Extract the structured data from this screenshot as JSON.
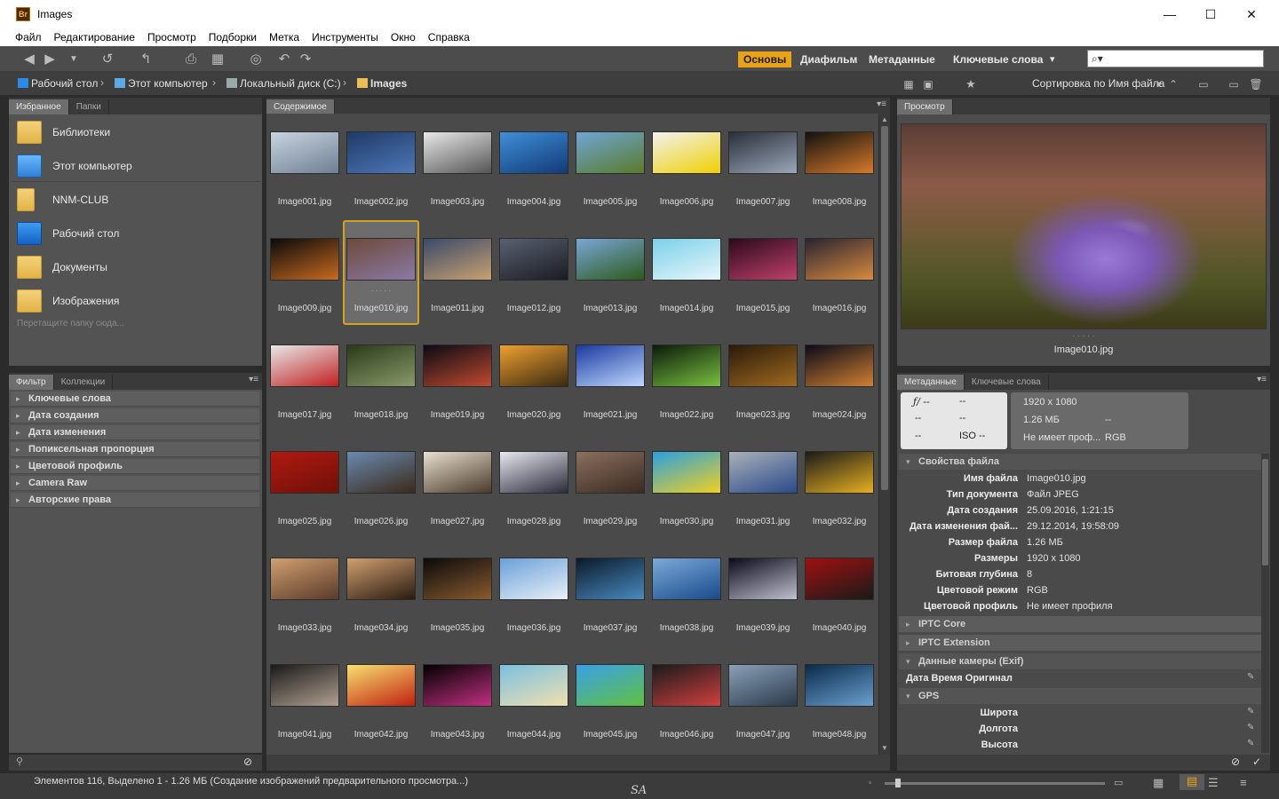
{
  "window": {
    "title": "Images",
    "icon_text": "Br",
    "min": "—",
    "max": "☐",
    "close": "✕"
  },
  "menu": [
    "Файл",
    "Редактирование",
    "Просмотр",
    "Подборки",
    "Метка",
    "Инструменты",
    "Окно",
    "Справка"
  ],
  "workspaces": {
    "essentials": "Основы",
    "filmstrip": "Диафильм",
    "metadata": "Метаданные",
    "keywords": "Ключевые слова",
    "more": "▾"
  },
  "search": {
    "placeholder": "⌕▾"
  },
  "path": {
    "desktop": "Рабочий стол",
    "computer": "Этот компьютер",
    "disk": "Локальный диск (C:)",
    "folder": "Images"
  },
  "sort": {
    "label": "Сортировка по Имя файла"
  },
  "favorites": {
    "tabs": [
      "Избранное",
      "Папки"
    ],
    "items": [
      "Библиотеки",
      "Этот компьютер",
      "NNM-CLUB",
      "Рабочий стол",
      "Документы",
      "Изображения"
    ],
    "drop_hint": "Перетащите папку сюда..."
  },
  "filter": {
    "tabs": [
      "Фильтр",
      "Коллекции"
    ],
    "rows": [
      "Ключевые слова",
      "Дата создания",
      "Дата изменения",
      "Попиксельная пропорция",
      "Цветовой профиль",
      "Camera Raw",
      "Авторские права"
    ]
  },
  "content": {
    "tab": "Содержимое",
    "selected_index": 9,
    "images": [
      {
        "name": "Image001.jpg",
        "c1": "#c8d4e0",
        "c2": "#6f7f92"
      },
      {
        "name": "Image002.jpg",
        "c1": "#1f3a66",
        "c2": "#4e78b8"
      },
      {
        "name": "Image003.jpg",
        "c1": "#e8e8e8",
        "c2": "#555"
      },
      {
        "name": "Image004.jpg",
        "c1": "#3f8fd8",
        "c2": "#123a78"
      },
      {
        "name": "Image005.jpg",
        "c1": "#6ea6d6",
        "c2": "#5a7a2a"
      },
      {
        "name": "Image006.jpg",
        "c1": "#f2f2f2",
        "c2": "#f0d000"
      },
      {
        "name": "Image007.jpg",
        "c1": "#2a2f3a",
        "c2": "#9aa6b8"
      },
      {
        "name": "Image008.jpg",
        "c1": "#111",
        "c2": "#d87a2a"
      },
      {
        "name": "Image009.jpg",
        "c1": "#0a0a0a",
        "c2": "#c86a20"
      },
      {
        "name": "Image010.jpg",
        "c1": "#6e4a3a",
        "c2": "#8a7aa6"
      },
      {
        "name": "Image011.jpg",
        "c1": "#3a4a6a",
        "c2": "#c8a070"
      },
      {
        "name": "Image012.jpg",
        "c1": "#5a6070",
        "c2": "#1a1c22"
      },
      {
        "name": "Image013.jpg",
        "c1": "#7aa6d6",
        "c2": "#2c5a1c"
      },
      {
        "name": "Image014.jpg",
        "c1": "#7ad0ea",
        "c2": "#e8f6fa"
      },
      {
        "name": "Image015.jpg",
        "c1": "#2a0a1a",
        "c2": "#c0406a"
      },
      {
        "name": "Image016.jpg",
        "c1": "#2a2430",
        "c2": "#d88a40"
      },
      {
        "name": "Image017.jpg",
        "c1": "#e8e8e8",
        "c2": "#c02020"
      },
      {
        "name": "Image018.jpg",
        "c1": "#2a3a1a",
        "c2": "#8a9a6a"
      },
      {
        "name": "Image019.jpg",
        "c1": "#0a0a14",
        "c2": "#c04a30"
      },
      {
        "name": "Image020.jpg",
        "c1": "#f0a030",
        "c2": "#3a2a10"
      },
      {
        "name": "Image021.jpg",
        "c1": "#1a3aa0",
        "c2": "#c0d8ff"
      },
      {
        "name": "Image022.jpg",
        "c1": "#0a1a0a",
        "c2": "#7ac040"
      },
      {
        "name": "Image023.jpg",
        "c1": "#2a1a0a",
        "c2": "#a06a20"
      },
      {
        "name": "Image024.jpg",
        "c1": "#0a0a1a",
        "c2": "#d08030"
      },
      {
        "name": "Image025.jpg",
        "c1": "#b01a10",
        "c2": "#701008"
      },
      {
        "name": "Image026.jpg",
        "c1": "#6a8ab0",
        "c2": "#3a2a1a"
      },
      {
        "name": "Image027.jpg",
        "c1": "#e8e0d0",
        "c2": "#4a3a2a"
      },
      {
        "name": "Image028.jpg",
        "c1": "#e8e8f0",
        "c2": "#2a2a3a"
      },
      {
        "name": "Image029.jpg",
        "c1": "#8a7060",
        "c2": "#3a2a20"
      },
      {
        "name": "Image030.jpg",
        "c1": "#2aa0e0",
        "c2": "#f0d020"
      },
      {
        "name": "Image031.jpg",
        "c1": "#aab0b8",
        "c2": "#2a4a8a"
      },
      {
        "name": "Image032.jpg",
        "c1": "#1a1a1a",
        "c2": "#e8b020"
      },
      {
        "name": "Image033.jpg",
        "c1": "#d0a070",
        "c2": "#5a3a2a"
      },
      {
        "name": "Image034.jpg",
        "c1": "#d0a070",
        "c2": "#2a1a10"
      },
      {
        "name": "Image035.jpg",
        "c1": "#0a0a0a",
        "c2": "#8a5a30"
      },
      {
        "name": "Image036.jpg",
        "c1": "#6aa0d8",
        "c2": "#e8f0f8"
      },
      {
        "name": "Image037.jpg",
        "c1": "#0a1a2a",
        "c2": "#4a8ac0"
      },
      {
        "name": "Image038.jpg",
        "c1": "#7aaad8",
        "c2": "#1a4a8a"
      },
      {
        "name": "Image039.jpg",
        "c1": "#0a0a1a",
        "c2": "#c0c0d0"
      },
      {
        "name": "Image040.jpg",
        "c1": "#a01010",
        "c2": "#1a1a1a"
      },
      {
        "name": "Image041.jpg",
        "c1": "#1a1a1a",
        "c2": "#b0a090"
      },
      {
        "name": "Image042.jpg",
        "c1": "#f8e070",
        "c2": "#c02010"
      },
      {
        "name": "Image043.jpg",
        "c1": "#000",
        "c2": "#c03080"
      },
      {
        "name": "Image044.jpg",
        "c1": "#7ac0e0",
        "c2": "#f0e0b0"
      },
      {
        "name": "Image045.jpg",
        "c1": "#3aa0ea",
        "c2": "#60c040"
      },
      {
        "name": "Image046.jpg",
        "c1": "#1a1a1a",
        "c2": "#d04040"
      },
      {
        "name": "Image047.jpg",
        "c1": "#8aa0b8",
        "c2": "#2a3a4a"
      },
      {
        "name": "Image048.jpg",
        "c1": "#0a2a4a",
        "c2": "#6aa0d0"
      }
    ]
  },
  "preview": {
    "tab": "Просмотр",
    "caption": "Image010.jpg",
    "dots": "· · · · ·"
  },
  "metadata": {
    "tabs": [
      "Метаданные",
      "Ключевые слова"
    ],
    "camera": {
      "aperture": "ƒ/ --",
      "shutter": "--",
      "a2": "--",
      "a3": "--",
      "a4": "--",
      "iso": "ISO --"
    },
    "file_box": {
      "dims": "1920 x 1080",
      "size": "1.26 МБ",
      "dash": "--",
      "profile": "Не имеет проф...",
      "mode": "RGB"
    },
    "sections": {
      "file": "Свойства файла",
      "iptc_core": "IPTC Core",
      "iptc_ext": "IPTC Extension",
      "exif": "Данные камеры (Exif)",
      "gps": "GPS"
    },
    "file_props": [
      {
        "k": "Имя файла",
        "v": "Image010.jpg"
      },
      {
        "k": "Тип документа",
        "v": "Файл JPEG"
      },
      {
        "k": "Дата создания",
        "v": "25.09.2016, 1:21:15"
      },
      {
        "k": "Дата изменения фай...",
        "v": "29.12.2014, 19:58:09"
      },
      {
        "k": "Размер файла",
        "v": "1.26 МБ"
      },
      {
        "k": "Размеры",
        "v": "1920 x 1080"
      },
      {
        "k": "Битовая глубина",
        "v": "8"
      },
      {
        "k": "Цветовой режим",
        "v": "RGB"
      },
      {
        "k": "Цветовой профиль",
        "v": "Не имеет профиля"
      }
    ],
    "exif_row": "Дата Время Оригинал",
    "gps_rows": [
      "Широта",
      "Долгота",
      "Высота"
    ]
  },
  "status": {
    "text": "Элементов 116, Выделено 1 - 1.26 МБ (Создание изображений предварительного просмотра...)",
    "watermark": "SA"
  },
  "colors": {
    "accent": "#e8a317",
    "panel": "#535353",
    "dark": "#3a3a3a"
  }
}
